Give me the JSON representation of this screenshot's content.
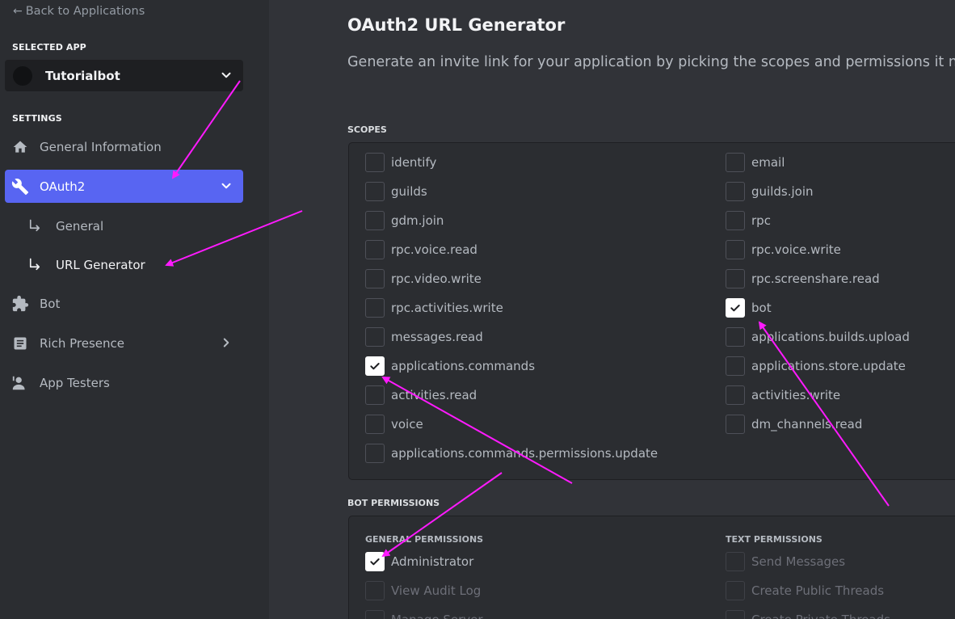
{
  "sidebar": {
    "back_label": "Back to Applications",
    "selected_app_label": "SELECTED APP",
    "app_name": "Tutorialbot",
    "settings_label": "SETTINGS",
    "items": [
      {
        "label": "General Information",
        "icon": "home-icon"
      },
      {
        "label": "OAuth2",
        "icon": "wrench-icon",
        "active": true
      },
      {
        "label": "General",
        "icon": "sub-arrow-icon"
      },
      {
        "label": "URL Generator",
        "icon": "sub-arrow-icon",
        "active": true
      },
      {
        "label": "Bot",
        "icon": "puzzle-icon"
      },
      {
        "label": "Rich Presence",
        "icon": "document-icon"
      },
      {
        "label": "App Testers",
        "icon": "user-icon"
      }
    ]
  },
  "main": {
    "title": "OAuth2 URL Generator",
    "description": "Generate an invite link for your application by picking the scopes and permissions it needs",
    "scopes_header": "SCOPES",
    "scopes_left": [
      {
        "label": "identify",
        "checked": false
      },
      {
        "label": "guilds",
        "checked": false
      },
      {
        "label": "gdm.join",
        "checked": false
      },
      {
        "label": "rpc.voice.read",
        "checked": false
      },
      {
        "label": "rpc.video.write",
        "checked": false
      },
      {
        "label": "rpc.activities.write",
        "checked": false
      },
      {
        "label": "messages.read",
        "checked": false
      },
      {
        "label": "applications.commands",
        "checked": true
      },
      {
        "label": "activities.read",
        "checked": false
      },
      {
        "label": "voice",
        "checked": false
      },
      {
        "label": "applications.commands.permissions.update",
        "checked": false
      }
    ],
    "scopes_right": [
      {
        "label": "email",
        "checked": false
      },
      {
        "label": "guilds.join",
        "checked": false
      },
      {
        "label": "rpc",
        "checked": false
      },
      {
        "label": "rpc.voice.write",
        "checked": false
      },
      {
        "label": "rpc.screenshare.read",
        "checked": false
      },
      {
        "label": "bot",
        "checked": true
      },
      {
        "label": "applications.builds.upload",
        "checked": false
      },
      {
        "label": "applications.store.update",
        "checked": false
      },
      {
        "label": "activities.write",
        "checked": false
      },
      {
        "label": "dm_channels.read",
        "checked": false
      }
    ],
    "bot_permissions_header": "BOT PERMISSIONS",
    "general_permissions_label": "GENERAL PERMISSIONS",
    "text_permissions_label": "TEXT PERMISSIONS",
    "general_permissions": [
      {
        "label": "Administrator",
        "checked": true,
        "disabled": false
      },
      {
        "label": "View Audit Log",
        "checked": false,
        "disabled": true
      },
      {
        "label": "Manage Server",
        "checked": false,
        "disabled": true
      }
    ],
    "text_permissions": [
      {
        "label": "Send Messages",
        "checked": false,
        "disabled": true
      },
      {
        "label": "Create Public Threads",
        "checked": false,
        "disabled": true
      },
      {
        "label": "Create Private Threads",
        "checked": false,
        "disabled": true
      }
    ]
  },
  "colors": {
    "accent": "#5865f2",
    "annotation": "#ff1aff",
    "sidebar_bg": "#2b2d31",
    "main_bg": "#313338"
  }
}
